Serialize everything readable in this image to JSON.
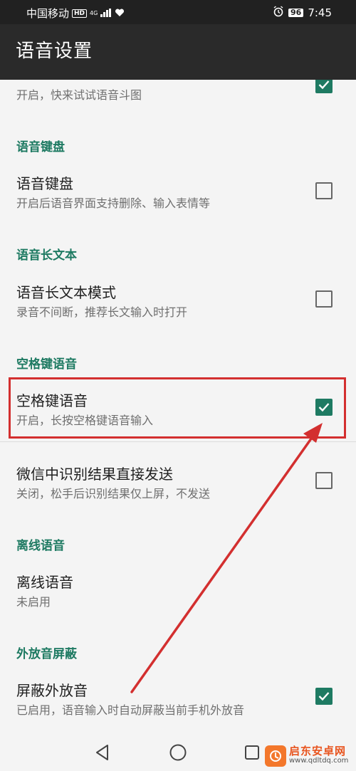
{
  "status_bar": {
    "carrier": "中国移动",
    "hd": "HD",
    "network": "4G",
    "battery": "96",
    "time": "7:45"
  },
  "app_bar": {
    "title": "语音设置"
  },
  "list": {
    "partial_item": {
      "summary": "开启，快来试试语音斗图",
      "checked": true
    },
    "sections": [
      {
        "header": "语音键盘",
        "items": [
          {
            "title": "语音键盘",
            "summary": "开启后语音界面支持删除、输入表情等",
            "checked": false
          }
        ]
      },
      {
        "header": "语音长文本",
        "items": [
          {
            "title": "语音长文本模式",
            "summary": "录音不间断，推荐长文输入时打开",
            "checked": false
          }
        ]
      },
      {
        "header": "空格键语音",
        "items": [
          {
            "title": "空格键语音",
            "summary": "开启，长按空格键语音输入",
            "checked": true
          },
          {
            "title": "微信中识别结果直接发送",
            "summary": "关闭，松手后识别结果仅上屏，不发送",
            "checked": false
          }
        ]
      },
      {
        "header": "离线语音",
        "items": [
          {
            "title": "离线语音",
            "summary": "未启用"
          }
        ]
      },
      {
        "header": "外放音屏蔽",
        "items": [
          {
            "title": "屏蔽外放音",
            "summary": "已启用，语音输入时自动屏蔽当前手机外放音",
            "checked": true
          }
        ]
      }
    ]
  },
  "watermark": {
    "name": "启东安卓网",
    "url": "www.qdltdq.com"
  },
  "colors": {
    "accent": "#1e7a62",
    "highlight": "#d32f2f",
    "app_bar": "#2a2a2a",
    "status_bar": "#212121"
  }
}
